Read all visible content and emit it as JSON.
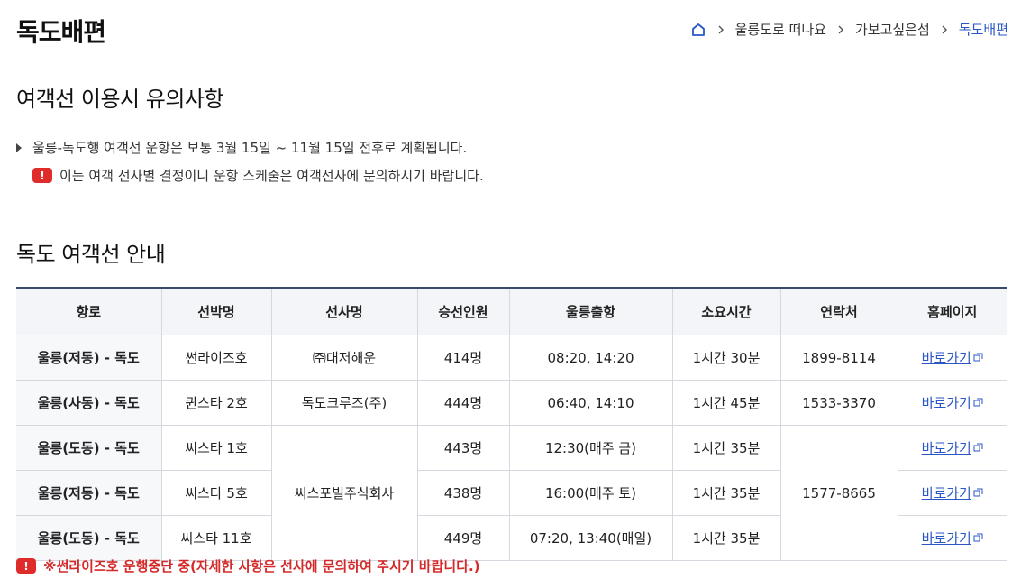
{
  "page_title": "독도배편",
  "breadcrumb": [
    "울릉도로 떠나요",
    "가보고싶은섬",
    "독도배편"
  ],
  "section1": {
    "title": "여객선 이용시 유의사항",
    "notice": "울릉-독도행 여객선 운항은 보통 3월 15일 ~ 11월 15일 전후로 계획됩니다.",
    "warning": "이는 여객 선사별 결정이니 운항 스케줄은 여객선사에 문의하시기 바랍니다.",
    "warn_symbol": "!"
  },
  "section2": {
    "title": "독도 여객선 안내"
  },
  "table": {
    "headers": [
      "항로",
      "선박명",
      "선사명",
      "승선인원",
      "울릉출항",
      "소요시간",
      "연락처",
      "홈페이지"
    ],
    "rows": [
      {
        "route": "울릉(저동) - 독도",
        "ship": "썬라이즈호",
        "company": "㈜대저해운",
        "capacity": "414명",
        "departure": "08:20, 14:20",
        "duration": "1시간 30분",
        "contact": "1899-8114",
        "link": "바로가기"
      },
      {
        "route": "울릉(사동) - 독도",
        "ship": "퀸스타 2호",
        "company": "독도크루즈(주)",
        "capacity": "444명",
        "departure": "06:40, 14:10",
        "duration": "1시간 45분",
        "contact": "1533-3370",
        "link": "바로가기"
      },
      {
        "route": "울릉(도동) - 독도",
        "ship": "씨스타 1호",
        "company": "씨스포빌주식회사",
        "capacity": "443명",
        "departure": "12:30(매주 금)",
        "duration": "1시간 35분",
        "contact": "1577-8665",
        "link": "바로가기"
      },
      {
        "route": "울릉(저동) - 독도",
        "ship": "씨스타 5호",
        "capacity": "438명",
        "departure": "16:00(매주 토)",
        "duration": "1시간 35분",
        "link": "바로가기"
      },
      {
        "route": "울릉(도동) - 독도",
        "ship": "씨스타 11호",
        "capacity": "449명",
        "departure": "07:20, 13:40(매일)",
        "duration": "1시간 35분",
        "link": "바로가기"
      }
    ]
  },
  "bottom_note": "※썬라이즈호 운행중단 중(자세한 사항은 선사에 문의하여 주시기 바랍니다.)",
  "colors": {
    "accent": "#2a56c6",
    "warning": "#e02b2b",
    "header_border": "#3a4a6b"
  },
  "icons": {
    "home": "home-icon",
    "separator": "chevron-right-icon",
    "external": "external-link-icon",
    "warning": "exclamation-icon"
  }
}
